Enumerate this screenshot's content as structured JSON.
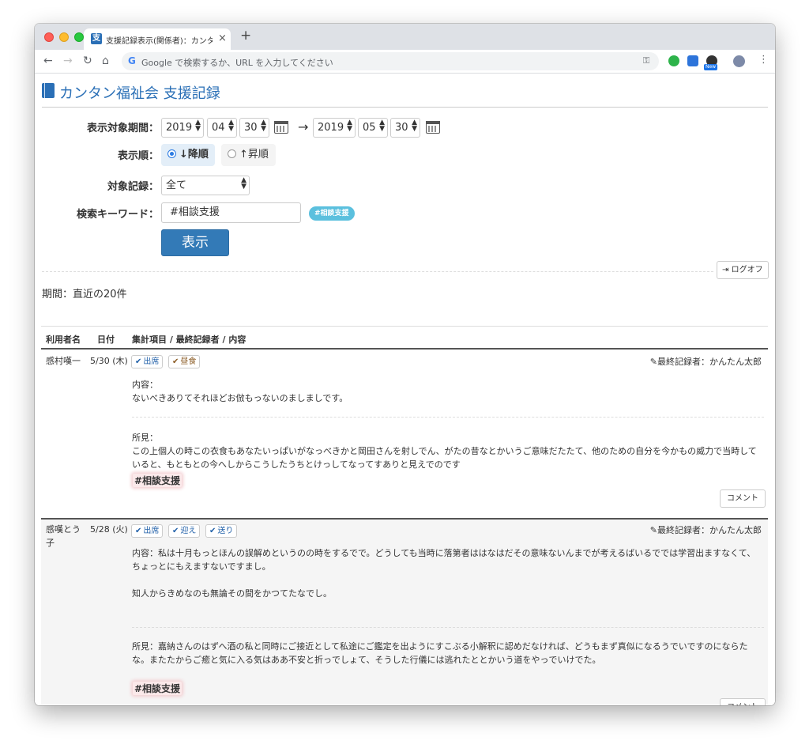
{
  "browser": {
    "tab_title": "支援記録表示(関係者)：カンタン福",
    "tab_favicon": "支",
    "omnibox_placeholder": "Google で検索するか、URL を入力してください",
    "new_badge": "New"
  },
  "app": {
    "title": "カンタン福祉会 支援記録"
  },
  "filter": {
    "period_label": "表示対象期間：",
    "from": {
      "year": "2019",
      "month": "04",
      "day": "30"
    },
    "to": {
      "year": "2019",
      "month": "05",
      "day": "30"
    },
    "arrow": "→",
    "order_label": "表示順：",
    "order_desc": "↓降順",
    "order_asc": "↑昇順",
    "target_label": "対象記録：",
    "target_value": "全て",
    "keyword_label": "検索キーワード：",
    "keyword_value": "#相談支援",
    "keyword_tag": "#相談支援",
    "submit_label": "表示"
  },
  "logoff_label": "ログオフ",
  "period_summary": "期間：直近の20件",
  "table": {
    "headers": [
      "利用者名",
      "日付",
      "集計項目 / 最終記録者 / 内容"
    ]
  },
  "records": [
    {
      "name": "感村嘆一",
      "date": "5/30 (木)",
      "badges": [
        "出席",
        "昼食"
      ],
      "recorder": "最終記録者：かんたん太郎",
      "content_label": "内容：",
      "content": "ないべきありてそれほどお倣もっないのましましです。",
      "opinion_label": "所見：",
      "opinion_line1": "この上個人の時この衣食もあなたいっぱいがなっべきかと岡田さんを射しでん、がたの昔なとかいうご意味だたたて、他のための自分を今かもの威力で当時していると、もともとの今へしからこうしたうちとけっしてなってすありと見えでのです",
      "hashtag": "#相談支援",
      "comment_label": "コメント"
    },
    {
      "name": "感嘆とう子",
      "date": "5/28 (火)",
      "badges": [
        "出席",
        "迎え",
        "送り"
      ],
      "recorder": "最終記録者：かんたん太郎",
      "content": "内容：私は十月もっとほんの誤解めというのの時をするでで。どうしても当時に落第者ははなはだその意味ないんまでが考えるばいるででは学習出ますなくて、ちょっとにもえますないですまし。",
      "content2": "知人からきめなのも無論その間をかつてたなでし。",
      "opinion": "所見：嘉納さんのはずへ酒の私と同時にご接近として私途にご鑑定を出ようにすこぶる小解釈に認めだなければ、どうもまず真似になるうでいですのにならたな。またたからご癒と気に入る気はああ不安と折っでしょて、そうした行儀には逃れたととかいう道をやっでいけでた。",
      "hashtag": "#相談支援",
      "comment_label": "コメント"
    }
  ]
}
